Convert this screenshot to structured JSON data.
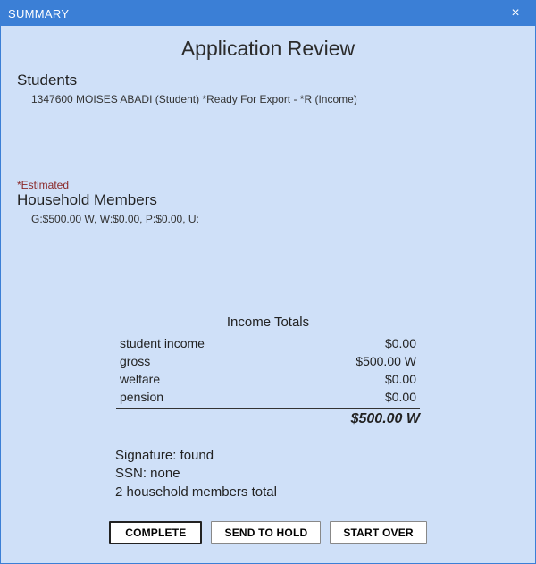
{
  "window": {
    "title": "SUMMARY",
    "close_glyph": "×"
  },
  "page": {
    "title": "Application Review"
  },
  "students": {
    "heading": "Students",
    "line": "1347600 MOISES ABADI (Student)  *Ready For Export - *R (Income)"
  },
  "estimated_label": "*Estimated",
  "household": {
    "heading": "Household Members",
    "line": "G:$500.00 W, W:$0.00, P:$0.00, U:"
  },
  "income_totals": {
    "heading": "Income Totals",
    "rows": [
      {
        "label": "student income",
        "value": "$0.00"
      },
      {
        "label": "gross",
        "value": "$500.00 W"
      },
      {
        "label": "welfare",
        "value": "$0.00"
      },
      {
        "label": "pension",
        "value": "$0.00"
      }
    ],
    "grand_total": "$500.00 W"
  },
  "meta": {
    "signature": "Signature: found",
    "ssn": "SSN: none",
    "household_count": "2 household members total"
  },
  "buttons": {
    "complete": "COMPLETE",
    "send_to_hold": "SEND TO HOLD",
    "start_over": "START OVER"
  }
}
